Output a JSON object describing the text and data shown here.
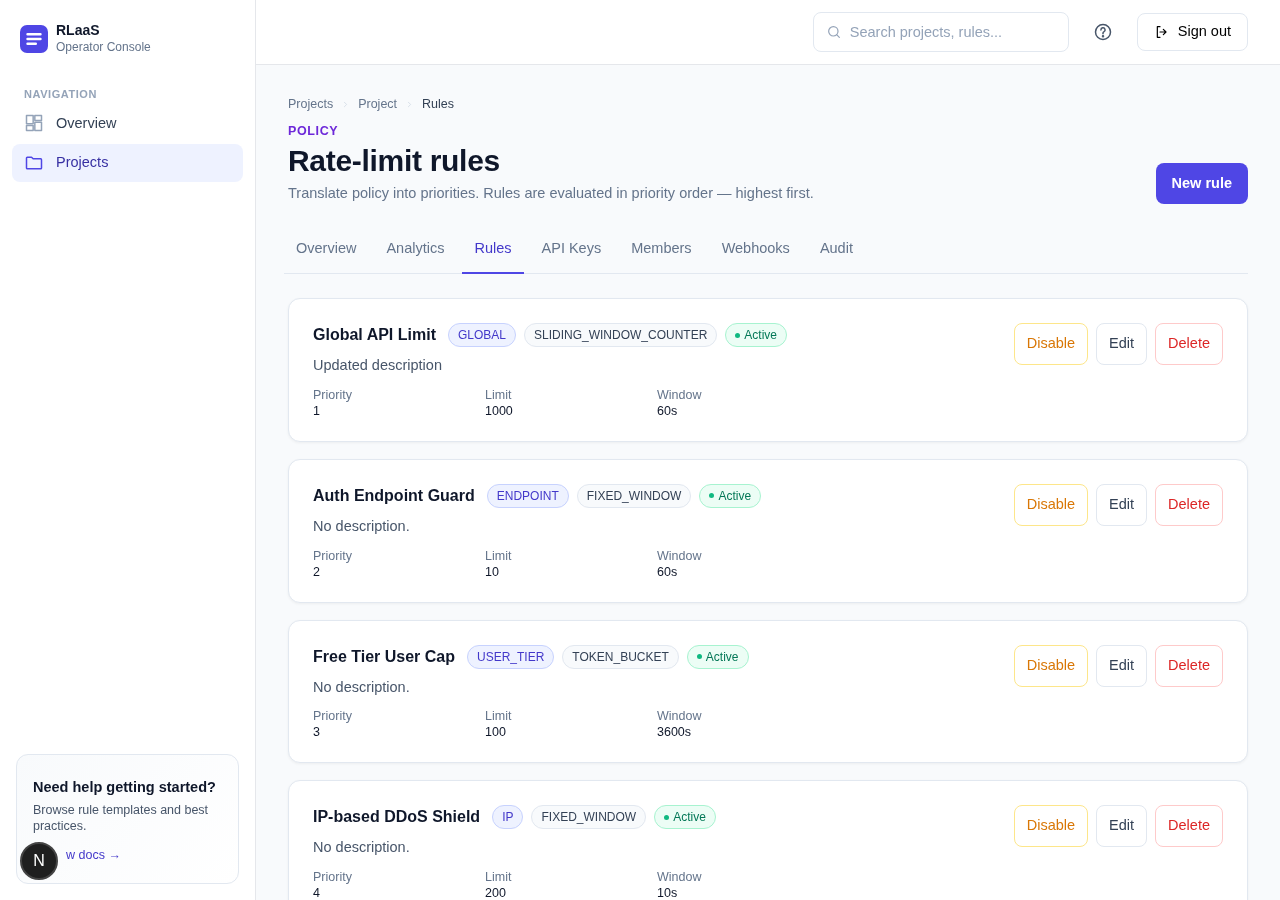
{
  "brand": {
    "name": "RLaaS",
    "subtitle": "Operator Console"
  },
  "sidebar": {
    "heading": "NAVIGATION",
    "items": [
      {
        "label": "Overview",
        "kind": "grid",
        "selected": false
      },
      {
        "label": "Projects",
        "kind": "folder",
        "selected": true
      }
    ]
  },
  "help_card": {
    "title": "Need help getting started?",
    "text": "Browse rule templates and best practices.",
    "link": "w docs",
    "link_arrow": "→",
    "badge": "N"
  },
  "header": {
    "search_placeholder": "Search projects, rules...",
    "sign_out": "Sign out"
  },
  "breadcrumb": [
    "Projects",
    "Project",
    "Rules"
  ],
  "eyebrow": "POLICY",
  "title": "Rate-limit rules",
  "subtitle": "Translate policy into priorities. Rules are evaluated in priority order — highest first.",
  "new_button": "New rule",
  "tabs": [
    {
      "label": "Overview",
      "selected": false
    },
    {
      "label": "Analytics",
      "selected": false
    },
    {
      "label": "Rules",
      "selected": true
    },
    {
      "label": "API Keys",
      "selected": false
    },
    {
      "label": "Members",
      "selected": false
    },
    {
      "label": "Webhooks",
      "selected": false
    },
    {
      "label": "Audit",
      "selected": false
    }
  ],
  "rules": [
    {
      "name": "Global API Limit",
      "scope": "GLOBAL",
      "algorithm": "SLIDING_WINDOW_COUNTER",
      "status": "Active",
      "active": true,
      "description": "Updated description",
      "fields": [
        {
          "label": "Priority",
          "value": "1"
        },
        {
          "label": "Limit",
          "value": "1000"
        },
        {
          "label": "Window",
          "value": "60s"
        }
      ],
      "actions": [
        "Disable",
        "Edit",
        "Delete"
      ]
    },
    {
      "name": "Auth Endpoint Guard",
      "scope": "ENDPOINT",
      "algorithm": "FIXED_WINDOW",
      "status": "Active",
      "active": true,
      "description": "No description.",
      "fields": [
        {
          "label": "Priority",
          "value": "2"
        },
        {
          "label": "Limit",
          "value": "10"
        },
        {
          "label": "Window",
          "value": "60s"
        }
      ],
      "actions": [
        "Disable",
        "Edit",
        "Delete"
      ]
    },
    {
      "name": "Free Tier User Cap",
      "scope": "USER_TIER",
      "algorithm": "TOKEN_BUCKET",
      "status": "Active",
      "active": true,
      "description": "No description.",
      "fields": [
        {
          "label": "Priority",
          "value": "3"
        },
        {
          "label": "Limit",
          "value": "100"
        },
        {
          "label": "Window",
          "value": "3600s"
        }
      ],
      "actions": [
        "Disable",
        "Edit",
        "Delete"
      ]
    },
    {
      "name": "IP-based DDoS Shield",
      "scope": "IP",
      "algorithm": "FIXED_WINDOW",
      "status": "Active",
      "active": true,
      "description": "No description.",
      "fields": [
        {
          "label": "Priority",
          "value": "4"
        },
        {
          "label": "Limit",
          "value": "200"
        },
        {
          "label": "Window",
          "value": "10s"
        }
      ],
      "actions": [
        "Disable",
        "Edit",
        "Delete"
      ]
    }
  ]
}
